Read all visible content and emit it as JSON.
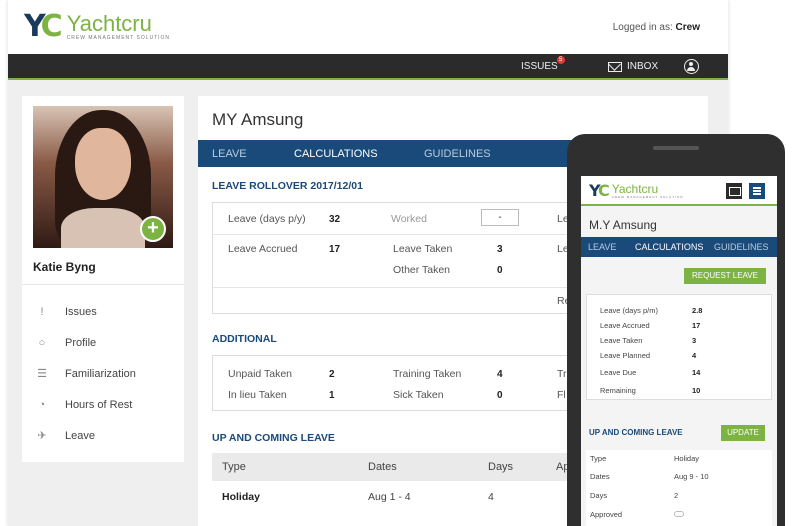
{
  "app": {
    "logo_name": "Yachtcru",
    "logo_tagline": "CREW MANAGEMENT SOLUTION",
    "logged_in_prefix": "Logged in as: ",
    "logged_in_user": "Crew"
  },
  "nav": {
    "issues_label": "ISSUES",
    "issues_count": "5",
    "inbox_label": "INBOX"
  },
  "profile": {
    "name": "Katie Byng"
  },
  "sidebar": {
    "items": [
      {
        "label": "Issues",
        "icon": "issues-icon"
      },
      {
        "label": "Profile",
        "icon": "profile-icon"
      },
      {
        "label": "Familiarization",
        "icon": "list-icon"
      },
      {
        "label": "Hours of Rest",
        "icon": "clock-icon"
      },
      {
        "label": "Leave",
        "icon": "plane-icon"
      }
    ]
  },
  "main": {
    "title": "MY Amsung",
    "tabs": [
      "LEAVE",
      "CALCULATIONS",
      "GUIDELINES"
    ],
    "rollover": {
      "title": "LEAVE ROLLOVER 2017/12/01",
      "leave_days_label": "Leave (days p/y)",
      "leave_days_value": "32",
      "worked_label": "Worked",
      "worked_button": "-",
      "leave_accrued_label": "Leave Accrued",
      "leave_accrued_value": "17",
      "leave_taken_label": "Leave Taken",
      "leave_taken_value": "3",
      "other_taken_label": "Other Taken",
      "other_taken_value": "0",
      "cut_le_1": "Le",
      "cut_le_2": "Le",
      "cut_re": "Re"
    },
    "additional": {
      "title": "ADDITIONAL",
      "unpaid_label": "Unpaid Taken",
      "unpaid_value": "2",
      "training_label": "Training Taken",
      "training_value": "4",
      "inlieu_label": "In lieu Taken",
      "inlieu_value": "1",
      "sick_label": "Sick Taken",
      "sick_value": "0",
      "cut_tr": "Tr",
      "cut_fl": "Fl"
    },
    "upcoming": {
      "title": "UP AND COMING LEAVE",
      "headers": [
        "Type",
        "Dates",
        "Days",
        "Ap"
      ],
      "rows": [
        {
          "type": "Holiday",
          "dates": "Aug 1 - 4",
          "days": "4"
        }
      ]
    }
  },
  "mobile": {
    "logo_name": "Yachtcru",
    "logo_tagline": "CREW MANAGEMENT SOLUTION",
    "title": "M.Y Amsung",
    "tabs": [
      "LEAVE",
      "CALCULATIONS",
      "GUIDELINES"
    ],
    "request_button": "REQUEST LEAVE",
    "stats": [
      {
        "label": "Leave (days p/m)",
        "value": "2.8"
      },
      {
        "label": "Leave Accrued",
        "value": "17"
      },
      {
        "label": "Leave Taken",
        "value": "3"
      },
      {
        "label": "Leave Planned",
        "value": "4"
      },
      {
        "label": "Leave Due",
        "value": "14"
      },
      {
        "label": "Remaining",
        "value": "10"
      }
    ],
    "upcoming_title": "UP AND COMING LEAVE",
    "update_button": "UPDATE",
    "details": [
      {
        "label": "Type",
        "value": "Holiday"
      },
      {
        "label": "Dates",
        "value": "Aug 9 - 10"
      },
      {
        "label": "Days",
        "value": "2"
      },
      {
        "label": "Approved",
        "value": ""
      }
    ]
  }
}
